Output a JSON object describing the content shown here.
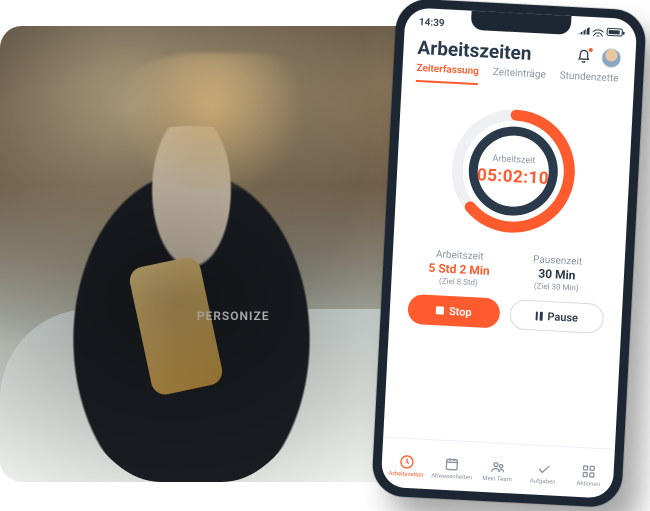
{
  "photo": {
    "sweatshirt_brand": "PERSONIZE"
  },
  "statusbar": {
    "time": "14:39"
  },
  "header": {
    "title": "Arbeitszeiten"
  },
  "tabs": [
    {
      "label": "Zeiterfassung",
      "active": true
    },
    {
      "label": "Zeiteinträge",
      "active": false
    },
    {
      "label": "Stundenzette",
      "active": false
    }
  ],
  "timer": {
    "ring_label": "Arbeitszeit",
    "elapsed": "05:02:10",
    "progress_fraction": 0.63
  },
  "stats": {
    "work": {
      "label": "Arbeitszeit",
      "value": "5 Std 2 Min",
      "goal": "(Ziel 8 Std)"
    },
    "pause": {
      "label": "Pausenzeit",
      "value": "30 Min",
      "goal": "(Ziel 30 Min)"
    }
  },
  "buttons": {
    "stop": "Stop",
    "pause": "Pause"
  },
  "bottom_nav": [
    {
      "label": "Arbeitszeiten",
      "icon": "clock-icon",
      "active": true
    },
    {
      "label": "Abwesenheiten",
      "icon": "calendar-icon",
      "active": false
    },
    {
      "label": "Mein Team",
      "icon": "team-icon",
      "active": false
    },
    {
      "label": "Aufgaben",
      "icon": "check-icon",
      "active": false
    },
    {
      "label": "Aktionen",
      "icon": "grid-icon",
      "active": false
    }
  ],
  "colors": {
    "accent": "#ff5b2e",
    "navy": "#2b3a4a"
  }
}
